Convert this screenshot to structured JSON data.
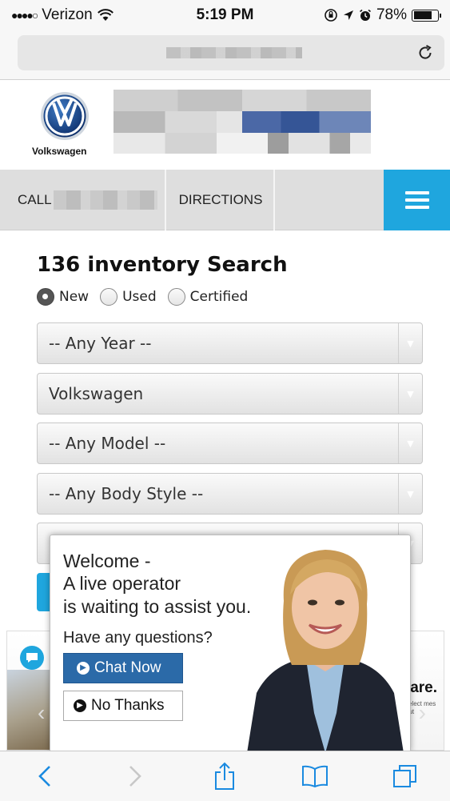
{
  "status_bar": {
    "signal": "●●●●○",
    "carrier": "Verizon",
    "time": "5:19 PM",
    "battery": "78%",
    "battery_level": 0.78
  },
  "header": {
    "brand_name": "Volkswagen"
  },
  "nav": {
    "call_label": "CALL",
    "directions_label": "DIRECTIONS"
  },
  "search": {
    "title": "136 inventory Search",
    "conditions": [
      {
        "label": "New",
        "checked": true
      },
      {
        "label": "Used",
        "checked": false
      },
      {
        "label": "Certified",
        "checked": false
      }
    ],
    "year": "-- Any Year --",
    "make": "Volkswagen",
    "model": "-- Any Model --",
    "body_style": "-- Any Body Style --"
  },
  "promo": {
    "text": "are.",
    "small": "select mes out"
  },
  "chat": {
    "line1": "Welcome -",
    "line2": "A live operator",
    "line3": "is waiting to assist you.",
    "question": "Have any questions?",
    "chat_now_label": "Chat Now",
    "no_thanks_label": "No Thanks"
  },
  "colors": {
    "accent": "#1fa6de",
    "chat_button": "#2b6aa8"
  }
}
